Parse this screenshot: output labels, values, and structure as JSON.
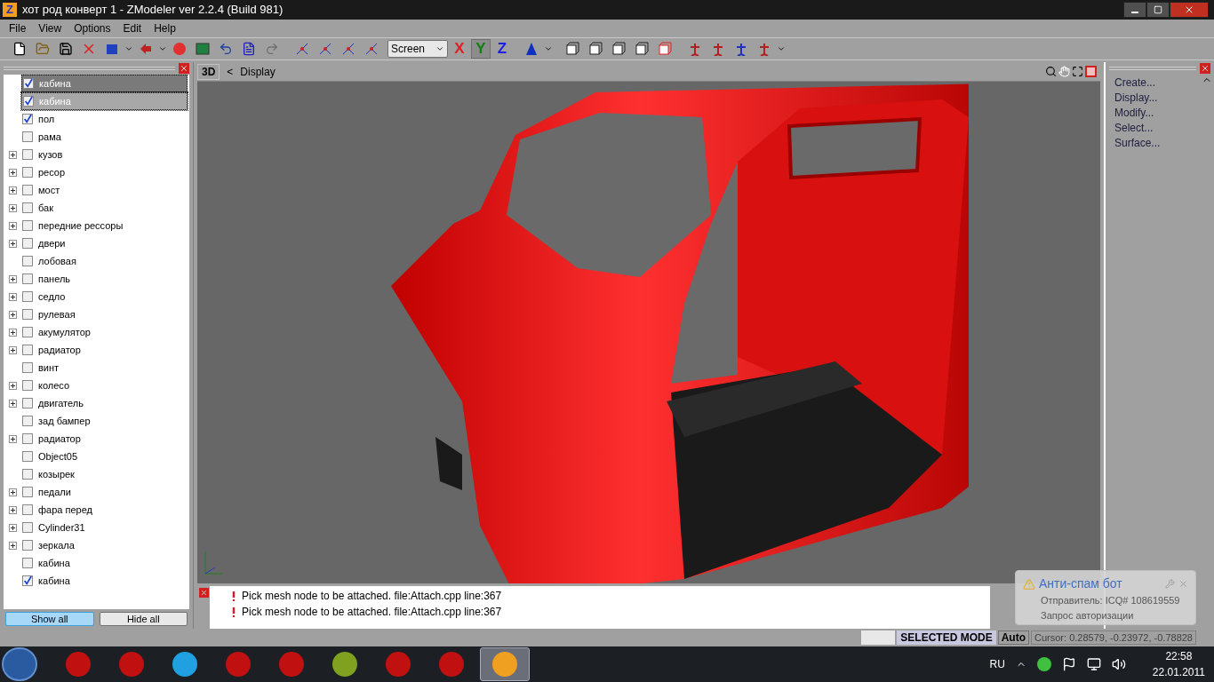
{
  "window": {
    "title": "хот род конверт 1 - ZModeler ver 2.2.4 (Build 981)",
    "app_letter": "Z"
  },
  "menu": [
    "File",
    "View",
    "Options",
    "Edit",
    "Help"
  ],
  "toolbar": {
    "coord_mode": "Screen",
    "axes": [
      {
        "label": "X",
        "color": "#e02020",
        "on": false
      },
      {
        "label": "Y",
        "color": "#108010",
        "on": true
      },
      {
        "label": "Z",
        "color": "#2020e0",
        "on": false
      }
    ]
  },
  "tree": {
    "items": [
      {
        "label": "кабина",
        "expandable": false,
        "checked": true,
        "selected": true,
        "focused": false
      },
      {
        "label": "кабина",
        "expandable": false,
        "checked": true,
        "selected": false,
        "focused": true
      },
      {
        "label": "пол",
        "expandable": false,
        "checked": true,
        "selected": false,
        "focused": false
      },
      {
        "label": "рама",
        "expandable": false,
        "checked": false,
        "selected": false,
        "focused": false
      },
      {
        "label": "кузов",
        "expandable": true,
        "checked": false,
        "selected": false,
        "focused": false
      },
      {
        "label": "ресор",
        "expandable": true,
        "checked": false,
        "selected": false,
        "focused": false
      },
      {
        "label": "мост",
        "expandable": true,
        "checked": false,
        "selected": false,
        "focused": false
      },
      {
        "label": "бак",
        "expandable": true,
        "checked": false,
        "selected": false,
        "focused": false
      },
      {
        "label": "передние рессоры",
        "expandable": true,
        "checked": false,
        "selected": false,
        "focused": false
      },
      {
        "label": "двери",
        "expandable": true,
        "checked": false,
        "selected": false,
        "focused": false
      },
      {
        "label": "лобовая",
        "expandable": false,
        "checked": false,
        "selected": false,
        "focused": false
      },
      {
        "label": "панель",
        "expandable": true,
        "checked": false,
        "selected": false,
        "focused": false
      },
      {
        "label": "седло",
        "expandable": true,
        "checked": false,
        "selected": false,
        "focused": false
      },
      {
        "label": "рулевая",
        "expandable": true,
        "checked": false,
        "selected": false,
        "focused": false
      },
      {
        "label": "акумулятор",
        "expandable": true,
        "checked": false,
        "selected": false,
        "focused": false
      },
      {
        "label": "радиатор",
        "expandable": true,
        "checked": false,
        "selected": false,
        "focused": false
      },
      {
        "label": "винт",
        "expandable": false,
        "checked": false,
        "selected": false,
        "focused": false
      },
      {
        "label": "колесо",
        "expandable": true,
        "checked": false,
        "selected": false,
        "focused": false
      },
      {
        "label": "двигатель",
        "expandable": true,
        "checked": false,
        "selected": false,
        "focused": false
      },
      {
        "label": "зад бампер",
        "expandable": false,
        "checked": false,
        "selected": false,
        "focused": false
      },
      {
        "label": "радиатор",
        "expandable": true,
        "checked": false,
        "selected": false,
        "focused": false
      },
      {
        "label": "Object05",
        "expandable": false,
        "checked": false,
        "selected": false,
        "focused": false
      },
      {
        "label": "козырек",
        "expandable": false,
        "checked": false,
        "selected": false,
        "focused": false
      },
      {
        "label": "педали",
        "expandable": true,
        "checked": false,
        "selected": false,
        "focused": false
      },
      {
        "label": "фара перед",
        "expandable": true,
        "checked": false,
        "selected": false,
        "focused": false
      },
      {
        "label": "Cylinder31",
        "expandable": true,
        "checked": false,
        "selected": false,
        "focused": false
      },
      {
        "label": "зеркала",
        "expandable": true,
        "checked": false,
        "selected": false,
        "focused": false
      },
      {
        "label": "кабина",
        "expandable": false,
        "checked": false,
        "selected": false,
        "focused": false
      },
      {
        "label": "кабина",
        "expandable": false,
        "checked": true,
        "selected": false,
        "focused": false
      }
    ],
    "buttons": [
      {
        "label": "Show all",
        "selected": true
      },
      {
        "label": "Hide all",
        "selected": false
      }
    ]
  },
  "viewport": {
    "mode": "3D",
    "back": "<",
    "title": "Display"
  },
  "commands": [
    "Create...",
    "Display...",
    "Modify...",
    "Select...",
    "Surface..."
  ],
  "log": [
    "Pick mesh node to be attached. file:Attach.cpp line:367",
    "Pick mesh node to be attached. file:Attach.cpp line:367"
  ],
  "status_bar": {
    "mode": "SELECTED MODE",
    "snap": "Auto",
    "cursor": "Cursor: 0.28579, -0.23972, -0.78828"
  },
  "notification": {
    "title": "Анти-спам бот",
    "sender": "Отправитель: ICQ# 108619559",
    "message": "Запрос авторизации"
  },
  "taskbar": {
    "apps": [
      {
        "selected": false
      },
      {
        "selected": false
      },
      {
        "selected": false
      },
      {
        "selected": false
      },
      {
        "selected": false
      },
      {
        "selected": false
      },
      {
        "selected": false
      },
      {
        "selected": false
      },
      {
        "selected": true
      }
    ],
    "language": "RU",
    "time": "22:58",
    "date": "22.01.2011"
  }
}
